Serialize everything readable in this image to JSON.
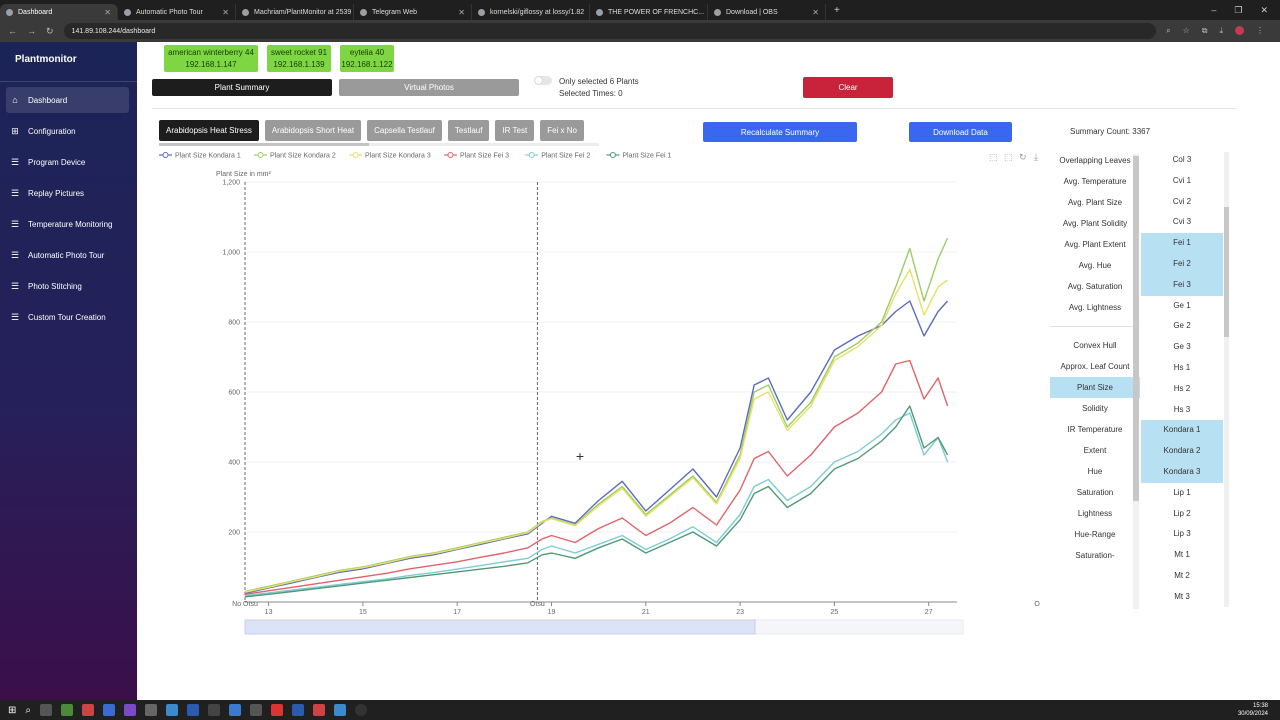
{
  "browser": {
    "tabs": [
      {
        "label": "Dashboard",
        "active": true
      },
      {
        "label": "Automatic Photo Tour",
        "active": false
      },
      {
        "label": "Machriam/PlantMonitor at 2539",
        "active": false
      },
      {
        "label": "Telegram Web",
        "active": false
      },
      {
        "label": "kornelski/giflossy at lossy/1.82",
        "active": false
      },
      {
        "label": "THE POWER OF FRENCHC...",
        "active": false
      },
      {
        "label": "Download | OBS",
        "active": false
      }
    ],
    "url": "141.89.108.244/dashboard"
  },
  "sidebar": {
    "brand": "Plantmonitor",
    "items": [
      {
        "label": "Dashboard",
        "icon": "home-icon",
        "active": true
      },
      {
        "label": "Configuration",
        "icon": "plus-square-icon"
      },
      {
        "label": "Program Device",
        "icon": "list-icon"
      },
      {
        "label": "Replay Pictures",
        "icon": "list-icon"
      },
      {
        "label": "Temperature Monitoring",
        "icon": "list-icon"
      },
      {
        "label": "Automatic Photo Tour",
        "icon": "list-icon"
      },
      {
        "label": "Photo Stitching",
        "icon": "list-icon"
      },
      {
        "label": "Custom Tour Creation",
        "icon": "list-icon"
      }
    ]
  },
  "devices": [
    {
      "name": "american winterberry 44",
      "ip": "192.168.1.147"
    },
    {
      "name": "sweet rocket 91",
      "ip": "192.168.1.139"
    },
    {
      "name": "eytelia 40",
      "ip": "192.168.1.122"
    }
  ],
  "controls": {
    "plant_summary": "Plant Summary",
    "virtual_photos": "Virtual Photos",
    "only_selected": "Only selected 6 Plants",
    "selected_times": "Selected Times: 0",
    "clear": "Clear",
    "recalculate": "Recalculate Summary",
    "download": "Download Data",
    "summary_count": "Summary Count: 3367"
  },
  "experiments": [
    "Arabidopsis Heat Stress",
    "Arabidopsis Short Heat",
    "Capsella Testlauf",
    "Testlauf",
    "IR Test",
    "Fei x No"
  ],
  "features": {
    "group1": [
      "Overlapping Leaves",
      "Avg. Temperature",
      "Avg. Plant Size",
      "Avg. Plant Solidity",
      "Avg. Plant Extent",
      "Avg. Hue",
      "Avg. Saturation",
      "Avg. Lightness"
    ],
    "group2": [
      "Convex Hull",
      "Approx. Leaf Count",
      "Plant Size",
      "Solidity",
      "IR Temperature",
      "Extent",
      "Hue",
      "Saturation",
      "Lightness",
      "Hue-Range",
      "Saturation-"
    ],
    "selected": "Plant Size"
  },
  "plants": [
    {
      "name": "Col 3",
      "sel": false
    },
    {
      "name": "Cvi 1",
      "sel": false
    },
    {
      "name": "Cvi 2",
      "sel": false
    },
    {
      "name": "Cvi 3",
      "sel": false
    },
    {
      "name": "Fei 1",
      "sel": true
    },
    {
      "name": "Fei 2",
      "sel": true
    },
    {
      "name": "Fei 3",
      "sel": true
    },
    {
      "name": "Ge 1",
      "sel": false
    },
    {
      "name": "Ge 2",
      "sel": false
    },
    {
      "name": "Ge 3",
      "sel": false
    },
    {
      "name": "Hs 1",
      "sel": false
    },
    {
      "name": "Hs 2",
      "sel": false
    },
    {
      "name": "Hs 3",
      "sel": false
    },
    {
      "name": "Kondara 1",
      "sel": true
    },
    {
      "name": "Kondara 2",
      "sel": true
    },
    {
      "name": "Kondara 3",
      "sel": true
    },
    {
      "name": "Lip 1",
      "sel": false
    },
    {
      "name": "Lip 2",
      "sel": false
    },
    {
      "name": "Lip 3",
      "sel": false
    },
    {
      "name": "Mt 1",
      "sel": false
    },
    {
      "name": "Mt 2",
      "sel": false
    },
    {
      "name": "Mt 3",
      "sel": false
    }
  ],
  "taskbar": {
    "time": "15:38",
    "date": "30/09/2024"
  },
  "chart_data": {
    "type": "line",
    "ylabel": "Plant Size in mm²",
    "ylim": [
      0,
      1200
    ],
    "yticks": [
      200,
      400,
      600,
      800,
      "1,000",
      "1,200"
    ],
    "xticks": [
      "13",
      "15",
      "17",
      "19",
      "21",
      "23",
      "25",
      "27"
    ],
    "xlim": [
      12.5,
      27.6
    ],
    "markers": [
      {
        "label": "No Otsu",
        "x": 12.5
      },
      {
        "label": "Otsu",
        "x": 18.7
      },
      {
        "label": "O",
        "x": 29.3
      }
    ],
    "series": [
      {
        "name": "Plant Size Kondara 1",
        "color": "#5b6bbf",
        "x": [
          12.5,
          13,
          13.5,
          14,
          14.5,
          15,
          15.5,
          16,
          16.5,
          17,
          17.5,
          18,
          18.5,
          18.8,
          19,
          19.5,
          20,
          20.5,
          21,
          21.5,
          22,
          22.5,
          23,
          23.3,
          23.6,
          24,
          24.5,
          25,
          25.5,
          26,
          26.3,
          26.6,
          26.9,
          27.2,
          27.4
        ],
        "y": [
          25,
          40,
          55,
          70,
          85,
          95,
          110,
          125,
          135,
          150,
          165,
          180,
          195,
          225,
          245,
          225,
          290,
          345,
          260,
          320,
          380,
          300,
          440,
          620,
          640,
          520,
          600,
          720,
          760,
          790,
          830,
          860,
          760,
          830,
          860
        ]
      },
      {
        "name": "Plant Size Kondara 2",
        "color": "#9ccc65",
        "x": [
          12.5,
          13,
          13.5,
          14,
          14.5,
          15,
          15.5,
          16,
          16.5,
          17,
          17.5,
          18,
          18.5,
          18.8,
          19,
          19.5,
          20,
          20.5,
          21,
          21.5,
          22,
          22.5,
          23,
          23.3,
          23.6,
          24,
          24.5,
          25,
          25.5,
          26,
          26.3,
          26.6,
          26.9,
          27.2,
          27.4
        ],
        "y": [
          30,
          45,
          60,
          75,
          90,
          100,
          115,
          130,
          140,
          155,
          170,
          185,
          200,
          230,
          240,
          220,
          280,
          330,
          250,
          305,
          360,
          285,
          420,
          600,
          620,
          500,
          570,
          700,
          740,
          800,
          900,
          1010,
          860,
          980,
          1040
        ]
      },
      {
        "name": "Plant Size Kondara 3",
        "color": "#e8e06a",
        "x": [
          12.5,
          13,
          13.5,
          14,
          14.5,
          15,
          15.5,
          16,
          16.5,
          17,
          17.5,
          18,
          18.5,
          18.8,
          19,
          19.5,
          20,
          20.5,
          21,
          21.5,
          22,
          22.5,
          23,
          23.3,
          23.6,
          24,
          24.5,
          25,
          25.5,
          26,
          26.3,
          26.6,
          26.9,
          27.2,
          27.4
        ],
        "y": [
          28,
          42,
          58,
          72,
          88,
          98,
          112,
          128,
          138,
          152,
          168,
          182,
          198,
          228,
          238,
          218,
          275,
          325,
          245,
          300,
          355,
          280,
          410,
          580,
          600,
          490,
          560,
          690,
          730,
          790,
          880,
          950,
          820,
          900,
          920
        ]
      },
      {
        "name": "Plant Size Fei 3",
        "color": "#e0636b",
        "x": [
          12.5,
          13,
          13.5,
          14,
          14.5,
          15,
          15.5,
          16,
          16.5,
          17,
          17.5,
          18,
          18.5,
          18.8,
          19,
          19.5,
          20,
          20.5,
          21,
          21.5,
          22,
          22.5,
          23,
          23.3,
          23.6,
          24,
          24.5,
          25,
          25.5,
          26,
          26.3,
          26.6,
          26.9,
          27.2,
          27.4
        ],
        "y": [
          22,
          32,
          42,
          52,
          62,
          72,
          82,
          95,
          105,
          115,
          128,
          140,
          155,
          180,
          190,
          170,
          210,
          240,
          190,
          225,
          270,
          220,
          320,
          410,
          430,
          360,
          420,
          500,
          540,
          600,
          680,
          690,
          580,
          640,
          560
        ]
      },
      {
        "name": "Plant Size Fei 2",
        "color": "#7fcbd6",
        "x": [
          12.5,
          13,
          13.5,
          14,
          14.5,
          15,
          15.5,
          16,
          16.5,
          17,
          17.5,
          18,
          18.5,
          18.8,
          19,
          19.5,
          20,
          20.5,
          21,
          21.5,
          22,
          22.5,
          23,
          23.3,
          23.6,
          24,
          24.5,
          25,
          25.5,
          26,
          26.3,
          26.6,
          26.9,
          27.2,
          27.4
        ],
        "y": [
          18,
          26,
          34,
          42,
          50,
          58,
          66,
          76,
          84,
          94,
          104,
          115,
          125,
          150,
          160,
          140,
          165,
          190,
          150,
          180,
          215,
          170,
          250,
          330,
          350,
          290,
          330,
          400,
          430,
          480,
          520,
          540,
          420,
          470,
          400
        ]
      },
      {
        "name": "Plant Size Fei 1",
        "color": "#4f9a74",
        "x": [
          12.5,
          13,
          13.5,
          14,
          14.5,
          15,
          15.5,
          16,
          16.5,
          17,
          17.5,
          18,
          18.5,
          18.8,
          19,
          19.5,
          20,
          20.5,
          21,
          21.5,
          22,
          22.5,
          23,
          23.3,
          23.6,
          24,
          24.5,
          25,
          25.5,
          26,
          26.3,
          26.6,
          26.9,
          27.2,
          27.4
        ],
        "y": [
          15,
          22,
          30,
          38,
          46,
          54,
          62,
          70,
          78,
          86,
          94,
          102,
          112,
          135,
          140,
          125,
          155,
          180,
          140,
          170,
          200,
          160,
          235,
          310,
          330,
          270,
          310,
          380,
          410,
          460,
          500,
          560,
          440,
          470,
          420
        ]
      }
    ]
  }
}
